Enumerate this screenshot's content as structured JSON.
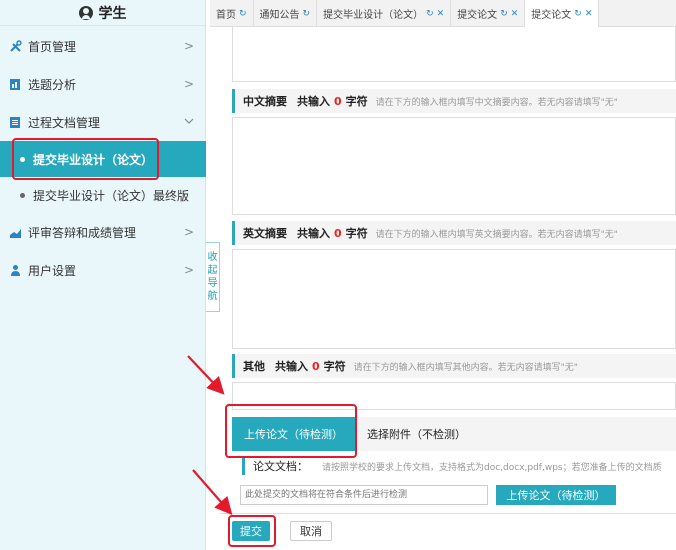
{
  "sidebar": {
    "title": "学生",
    "items": [
      {
        "label": "首页管理",
        "icon": "tools-icon"
      },
      {
        "label": "选题分析",
        "icon": "chart-doc-icon"
      },
      {
        "label": "过程文档管理",
        "icon": "document-icon"
      },
      {
        "label": "评审答辩和成绩管理",
        "icon": "trend-icon"
      },
      {
        "label": "用户设置",
        "icon": "person-icon"
      }
    ],
    "sub_items": [
      {
        "label": "提交毕业设计（论文）",
        "active": true
      },
      {
        "label": "提交毕业设计（论文）最终版",
        "active": false
      }
    ],
    "collapse_label": [
      "收",
      "起",
      "导",
      "航"
    ]
  },
  "tabs": [
    {
      "label": "首页"
    },
    {
      "label": "通知公告"
    },
    {
      "label": "提交毕业设计（论文）"
    },
    {
      "label": "提交论文"
    },
    {
      "label": "提交论文",
      "active": true
    }
  ],
  "sections": {
    "cn_abstract": {
      "label": "中文摘要",
      "count_prefix": "共输入",
      "count": "0",
      "count_suffix": "字符",
      "hint": "请在下方的输入框内填写中文摘要内容。若无内容请填写\"无\""
    },
    "en_abstract": {
      "label": "英文摘要",
      "count_prefix": "共输入",
      "count": "0",
      "count_suffix": "字符",
      "hint": "请在下方的输入框内填写英文摘要内容。若无内容请填写\"无\""
    },
    "other": {
      "label": "其他",
      "count_prefix": "共输入",
      "count": "0",
      "count_suffix": "字符",
      "hint": "请在下方的输入框内填写其他内容。若无内容请填写\"无\""
    }
  },
  "upload": {
    "tab_paper": "上传论文（待检测）",
    "tab_attach": "选择附件（不检测）",
    "file_label": "论文文档：",
    "file_hint": "请按照学校的要求上传文档，支持格式为doc,docx,pdf,wps；若您准备上传的文档质",
    "file_placeholder": "此处提交的文档将在符合条件后进行检测",
    "upload_button": "上传论文（待检测）"
  },
  "actions": {
    "submit": "提交",
    "cancel": "取消"
  },
  "colors": {
    "accent": "#26a8bd",
    "highlight": "#e3192c",
    "count": "#e22222"
  }
}
